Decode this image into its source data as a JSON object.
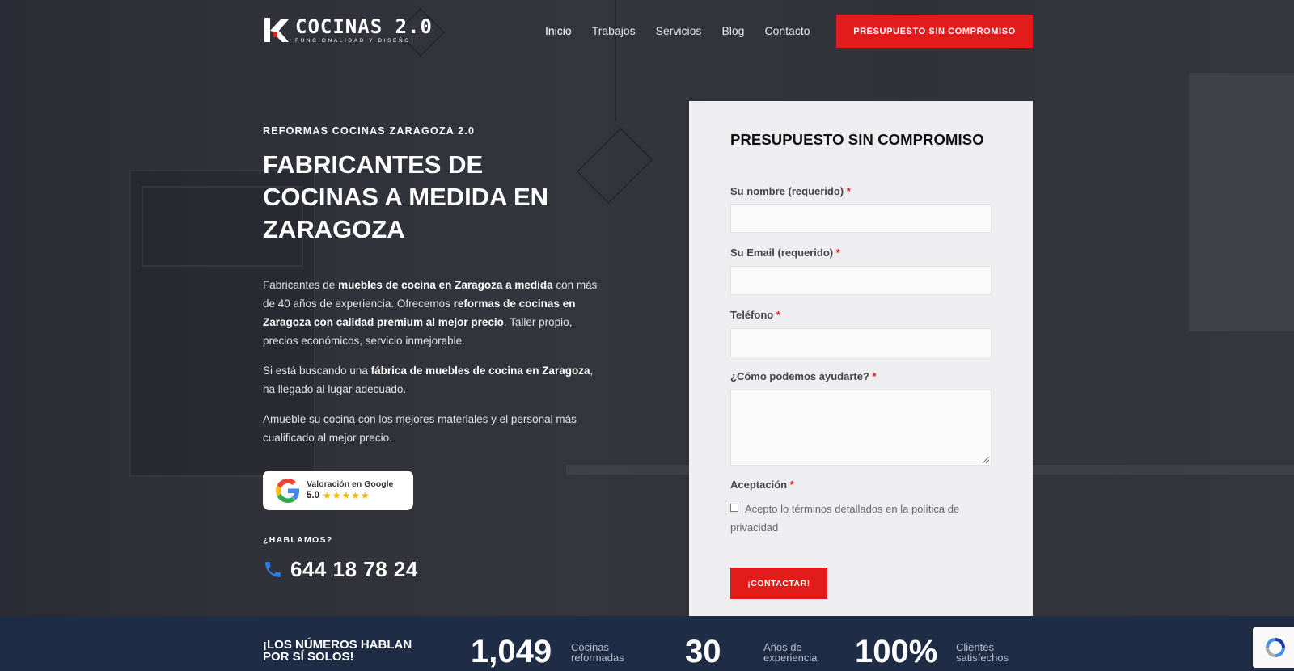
{
  "header": {
    "logo_title": "COCINAS 2.0",
    "logo_subtitle": "FUNCIONALIDAD Y DISEÑO",
    "nav": [
      "Inicio",
      "Trabajos",
      "Servicios",
      "Blog",
      "Contacto"
    ],
    "active_nav": "Inicio",
    "cta_label": "PRESUPUESTO SIN COMPROMISO"
  },
  "hero": {
    "kicker": "REFORMAS COCINAS ZARAGOZA 2.0",
    "title": "FABRICANTES DE COCINAS A MEDIDA EN ZARAGOZA",
    "p1": [
      {
        "t": "Fabricantes de ",
        "b": false
      },
      {
        "t": "muebles de cocina en Zaragoza a medida",
        "b": true
      },
      {
        "t": " con más de 40 años de experiencia. Ofrecemos ",
        "b": false
      },
      {
        "t": "reformas de cocinas en Zaragoza con calidad premium al mejor precio",
        "b": true
      },
      {
        "t": ". Taller propio, precios económicos, servicio inmejorable.",
        "b": false
      }
    ],
    "p2": [
      {
        "t": "Si está buscando una ",
        "b": false
      },
      {
        "t": "fábrica de muebles de cocina en Zaragoza",
        "b": true
      },
      {
        "t": ", ha llegado al lugar adecuado.",
        "b": false
      }
    ],
    "p3": "Amueble su cocina con los mejores materiales y el personal más cualificado al mejor precio.",
    "google_badge": {
      "label": "Valoración en Google",
      "score": "5.0",
      "stars": "★★★★★",
      "rating": 5
    },
    "talk_label": "¿HABLAMOS?",
    "phone": "644 18 78 24"
  },
  "form": {
    "title": "PRESUPUESTO SIN COMPROMISO",
    "required_mark": "*",
    "fields": [
      {
        "label": "Su nombre (requerido)",
        "value": ""
      },
      {
        "label": "Su Email (requerido)",
        "value": ""
      },
      {
        "label": "Teléfono",
        "value": ""
      },
      {
        "label": "¿Cómo podemos ayudarte?",
        "value": ""
      }
    ],
    "acceptance_label": "Aceptación",
    "acceptance_text": "Acepto lo términos detallados en la política de privacidad",
    "acceptance_checked": false,
    "submit_label": "¡CONTACTAR!"
  },
  "stats": {
    "title": "¡LOS NÚMEROS HABLAN POR SÍ SOLOS!",
    "items": [
      {
        "value": "1,049",
        "label": "Cocinas reformadas"
      },
      {
        "value": "30",
        "label": "Años de experiencia"
      },
      {
        "value": "100%",
        "label": "Clientes satisfechos"
      }
    ]
  },
  "colors": {
    "accent": "#e21b1b",
    "stats_bg": "#1f2c46",
    "form_bg": "#eeeef1"
  },
  "icons": [
    "logo-mark-icon",
    "google-g-icon",
    "star-icon",
    "phone-icon",
    "recaptcha-icon"
  ]
}
